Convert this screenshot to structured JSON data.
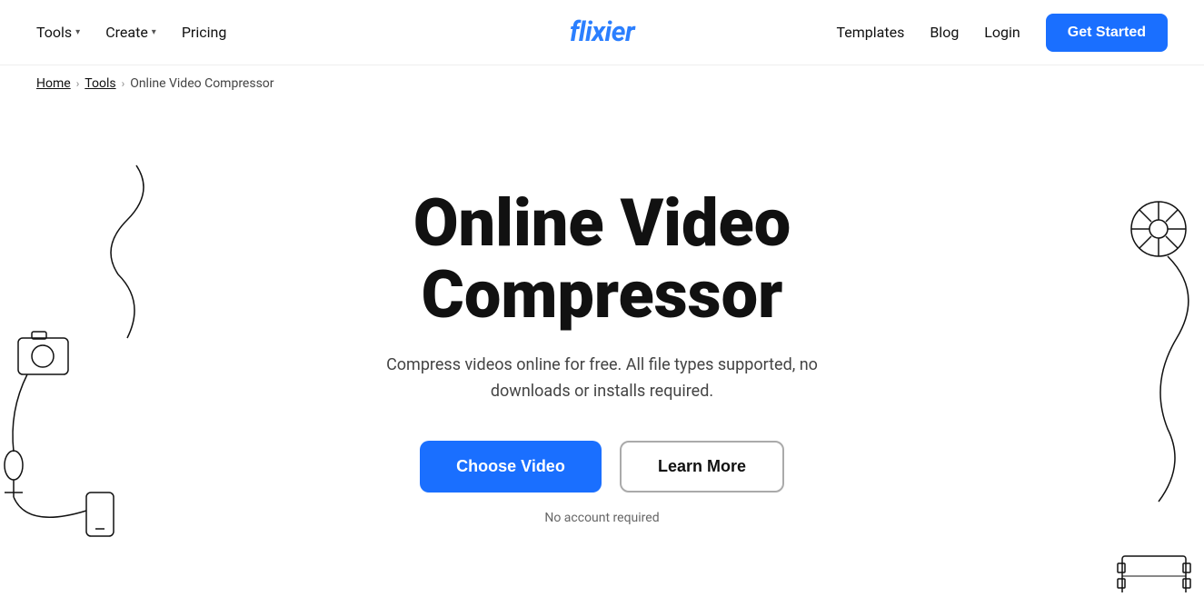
{
  "header": {
    "logo": "flixier",
    "nav_left": [
      {
        "label": "Tools",
        "has_arrow": true
      },
      {
        "label": "Create",
        "has_arrow": true
      },
      {
        "label": "Pricing",
        "has_arrow": false
      }
    ],
    "nav_right": [
      {
        "label": "Templates"
      },
      {
        "label": "Blog"
      },
      {
        "label": "Login"
      }
    ],
    "cta_label": "Get Started"
  },
  "breadcrumb": {
    "home": "Home",
    "tools": "Tools",
    "current": "Online Video Compressor"
  },
  "hero": {
    "title_line1": "Online Video",
    "title_line2": "Compressor",
    "subtitle": "Compress videos online for free. All file types supported, no downloads or installs required.",
    "btn_choose": "Choose Video",
    "btn_learn": "Learn More",
    "no_account": "No account required"
  },
  "colors": {
    "accent": "#1a6fff",
    "text_dark": "#111111",
    "text_muted": "#666666",
    "border": "#aaaaaa"
  }
}
